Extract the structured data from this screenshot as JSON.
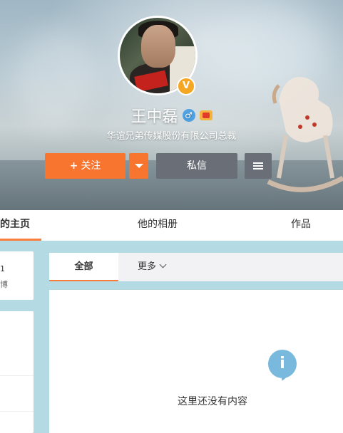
{
  "profile": {
    "name": "王中磊",
    "title": "华谊兄弟传媒股份有限公司总裁",
    "verified_icon": "verified-v-icon",
    "gender_icon": "male-icon",
    "vip_icon": "vip-badge-icon"
  },
  "actions": {
    "follow_plus": "+",
    "follow_label": "关注",
    "message_label": "私信",
    "dropdown_icon": "caret-down-icon",
    "menu_icon": "menu-icon"
  },
  "tabs": [
    {
      "label": "他的主页",
      "active": true
    },
    {
      "label": "他的相册"
    },
    {
      "label": "作品"
    }
  ],
  "side_card": {
    "line1": "1",
    "line2": "博"
  },
  "feed": {
    "filter_all": "全部",
    "filter_more": "更多",
    "empty_text": "这里还没有内容",
    "empty_icon": "info-icon"
  },
  "colors": {
    "accent": "#fa7d3c",
    "follow": "#f7752f",
    "secondary_btn": "#6a6f77",
    "page_bg": "#b4dbe4",
    "info_icon": "#7ab9de"
  }
}
